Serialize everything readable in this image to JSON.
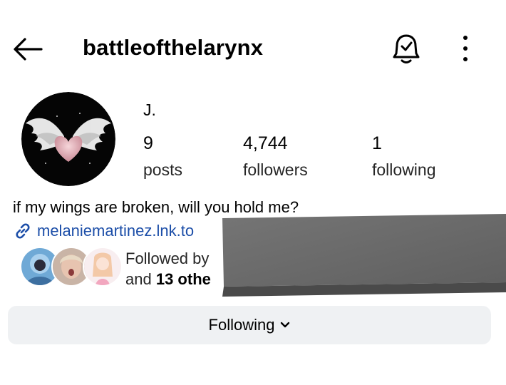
{
  "header": {
    "username": "battleofthelarynx",
    "icons": {
      "back": "back-arrow-icon",
      "notifications": "bell-check-icon",
      "more": "more-vertical-icon"
    }
  },
  "profile": {
    "display_name": "J.",
    "stats": [
      {
        "value": "9",
        "label": "posts"
      },
      {
        "value": "4,744",
        "label": "followers"
      },
      {
        "value": "1",
        "label": "following"
      }
    ],
    "bio": "if my wings are broken, will you hold me?",
    "link": "melaniemartinez.lnk.to",
    "followed_by_line1": "Followed by",
    "followed_by_prefix": "and",
    "followed_by_count": "13 othe"
  },
  "actions": {
    "following_label": "Following"
  },
  "colors": {
    "link": "#1c4ea8",
    "button_bg": "#eff1f3",
    "redaction": "#6f6f6f"
  }
}
